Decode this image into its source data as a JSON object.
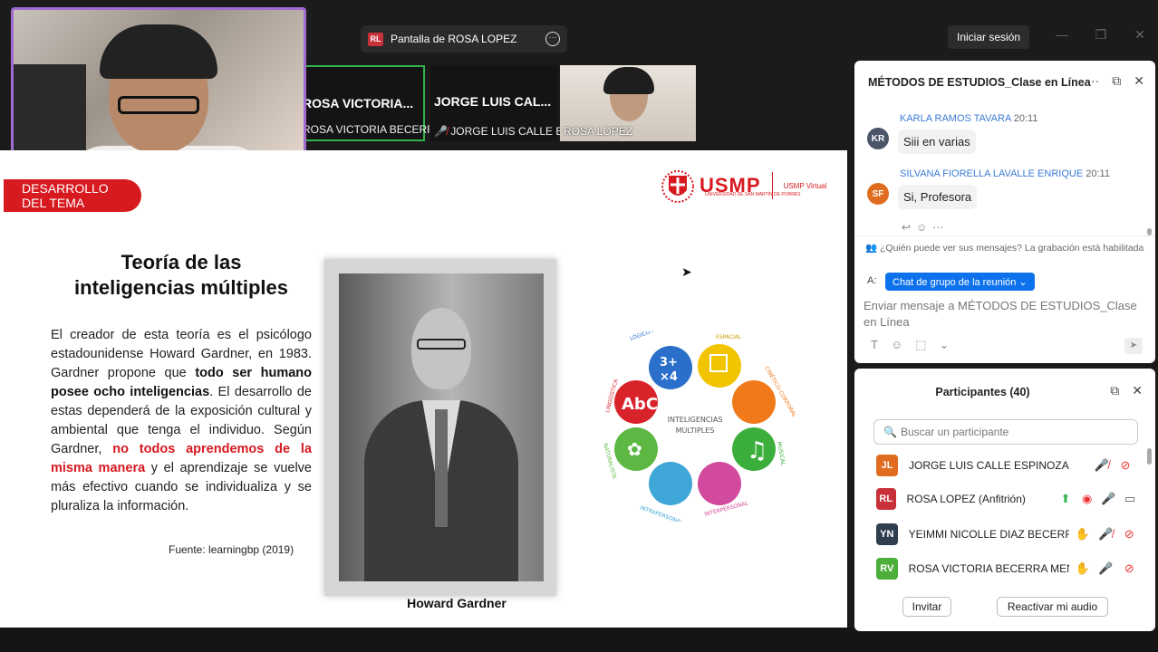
{
  "window": {
    "share_tab_label": "Pantalla de ROSA LOPEZ",
    "share_tab_badge": "RL",
    "signin_label": "Iniciar sesión"
  },
  "thumbnails": [
    {
      "name": "ROSA VICTORIA...",
      "sub": "ROSA VICTORIA BECERR..."
    },
    {
      "name": "JORGE LUIS CAL...",
      "sub": "JORGE LUIS CALLE ES..."
    },
    {
      "name": "",
      "sub": "ROSA LOPEZ"
    }
  ],
  "slide": {
    "banner": "DESARROLLO\nDEL TEMA",
    "banner_line1": "DESARROLLO",
    "banner_line2": "DEL TEMA",
    "logo_text": "USMP",
    "logo_sub": "UNIVERSIDAD DE SAN MARTÍN DE PORRES",
    "logo_virtual": "USMP Virtual",
    "title_line1": "Teoría de las",
    "title_line2": "inteligencias múltiples",
    "body_part1": "El creador de esta teoría es el psicólogo estadounidense Howard Gardner, en 1983. Gardner propone que ",
    "body_bold": "todo ser humano posee ocho inteligencias",
    "body_part2": ". El desarrollo de estas dependerá de la exposición cultural y ambiental que tenga el individuo. Según Gardner, ",
    "body_red": "no todos aprendemos de la misma manera",
    "body_part3": " y el aprendizaje se vuelve más efectivo cuando se individualiza y se pluraliza la información.",
    "source": "Fuente: learningbp (2019)",
    "photo_caption": "Howard Gardner",
    "wheel_center": "INTELIGENCIAS MÚLTIPLES",
    "wheel_labels": [
      "LÓGICO-MATEMÁTICA",
      "ESPACIAL",
      "CINÉTICO-CORPORAL",
      "MUSICAL",
      "INTERPERSONAL",
      "INTRAPERSONAL",
      "NATURALISTA",
      "LINGÜÍSTICA"
    ],
    "wheel_math": "3+\n×4"
  },
  "chat": {
    "title": "MÉTODOS DE ESTUDIOS_Clase en Línea",
    "messages": [
      {
        "initials": "KR",
        "name": "KARLA RAMOS TAVARA",
        "time": "20:11",
        "text": "Siii en varias",
        "color": "#4a5568"
      },
      {
        "initials": "SF",
        "name": "SILVANA FIORELLA LAVALLE ENRIQUE",
        "time": "20:11",
        "text": "Si, Profesora",
        "color": "#e06c1f"
      }
    ],
    "privacy": "¿Quién puede ver sus mensajes? La grabación está habilitada",
    "to_label": "A:",
    "group_label": "Chat de grupo de la reunión ⌄",
    "input_placeholder": "Enviar mensaje a MÉTODOS DE ESTUDIOS_Clase en Línea"
  },
  "participants": {
    "title": "Participantes (40)",
    "search_placeholder": "Buscar un participante",
    "list": [
      {
        "initials": "JL",
        "name": "JORGE LUIS CALLE ESPINOZA (Yo)",
        "color": "#e06c1f"
      },
      {
        "initials": "RL",
        "name": "ROSA LOPEZ (Anfitrión)",
        "color": "#c8313a"
      },
      {
        "initials": "YN",
        "name": "YEIMMI NICOLLE DIAZ BECERRA",
        "color": "#2f3e4e"
      },
      {
        "initials": "RV",
        "name": "ROSA VICTORIA BECERRA MEN...",
        "color": "#4cae3b"
      }
    ],
    "invite_label": "Invitar",
    "reactivate_label": "Reactivar mi audio"
  },
  "colors": {
    "accent": "#0e72ed",
    "brand_red": "#d71920",
    "self_border": "#a16bd2"
  }
}
